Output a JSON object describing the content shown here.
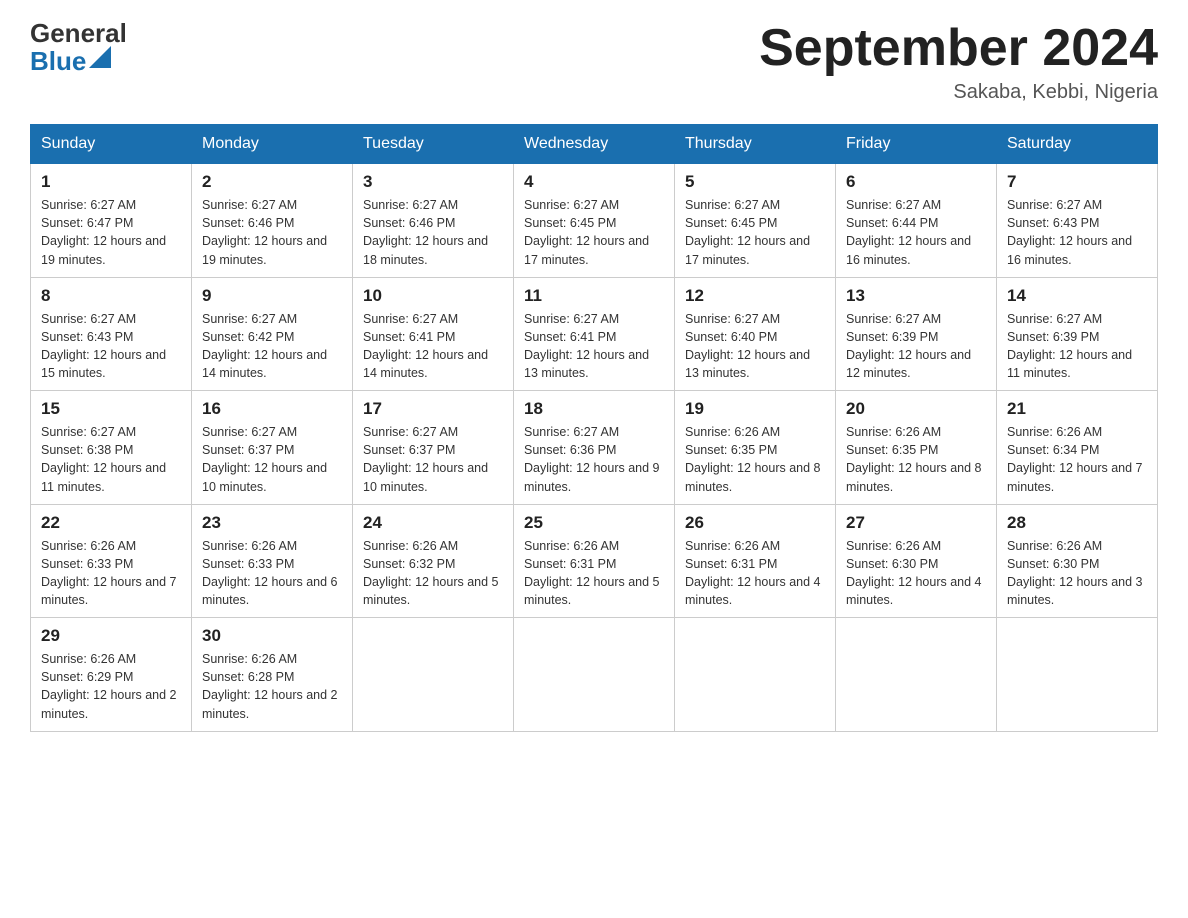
{
  "header": {
    "logo_general": "General",
    "logo_blue": "Blue",
    "month_title": "September 2024",
    "location": "Sakaba, Kebbi, Nigeria"
  },
  "days_of_week": [
    "Sunday",
    "Monday",
    "Tuesday",
    "Wednesday",
    "Thursday",
    "Friday",
    "Saturday"
  ],
  "weeks": [
    [
      {
        "day": "1",
        "sunrise": "Sunrise: 6:27 AM",
        "sunset": "Sunset: 6:47 PM",
        "daylight": "Daylight: 12 hours and 19 minutes."
      },
      {
        "day": "2",
        "sunrise": "Sunrise: 6:27 AM",
        "sunset": "Sunset: 6:46 PM",
        "daylight": "Daylight: 12 hours and 19 minutes."
      },
      {
        "day": "3",
        "sunrise": "Sunrise: 6:27 AM",
        "sunset": "Sunset: 6:46 PM",
        "daylight": "Daylight: 12 hours and 18 minutes."
      },
      {
        "day": "4",
        "sunrise": "Sunrise: 6:27 AM",
        "sunset": "Sunset: 6:45 PM",
        "daylight": "Daylight: 12 hours and 17 minutes."
      },
      {
        "day": "5",
        "sunrise": "Sunrise: 6:27 AM",
        "sunset": "Sunset: 6:45 PM",
        "daylight": "Daylight: 12 hours and 17 minutes."
      },
      {
        "day": "6",
        "sunrise": "Sunrise: 6:27 AM",
        "sunset": "Sunset: 6:44 PM",
        "daylight": "Daylight: 12 hours and 16 minutes."
      },
      {
        "day": "7",
        "sunrise": "Sunrise: 6:27 AM",
        "sunset": "Sunset: 6:43 PM",
        "daylight": "Daylight: 12 hours and 16 minutes."
      }
    ],
    [
      {
        "day": "8",
        "sunrise": "Sunrise: 6:27 AM",
        "sunset": "Sunset: 6:43 PM",
        "daylight": "Daylight: 12 hours and 15 minutes."
      },
      {
        "day": "9",
        "sunrise": "Sunrise: 6:27 AM",
        "sunset": "Sunset: 6:42 PM",
        "daylight": "Daylight: 12 hours and 14 minutes."
      },
      {
        "day": "10",
        "sunrise": "Sunrise: 6:27 AM",
        "sunset": "Sunset: 6:41 PM",
        "daylight": "Daylight: 12 hours and 14 minutes."
      },
      {
        "day": "11",
        "sunrise": "Sunrise: 6:27 AM",
        "sunset": "Sunset: 6:41 PM",
        "daylight": "Daylight: 12 hours and 13 minutes."
      },
      {
        "day": "12",
        "sunrise": "Sunrise: 6:27 AM",
        "sunset": "Sunset: 6:40 PM",
        "daylight": "Daylight: 12 hours and 13 minutes."
      },
      {
        "day": "13",
        "sunrise": "Sunrise: 6:27 AM",
        "sunset": "Sunset: 6:39 PM",
        "daylight": "Daylight: 12 hours and 12 minutes."
      },
      {
        "day": "14",
        "sunrise": "Sunrise: 6:27 AM",
        "sunset": "Sunset: 6:39 PM",
        "daylight": "Daylight: 12 hours and 11 minutes."
      }
    ],
    [
      {
        "day": "15",
        "sunrise": "Sunrise: 6:27 AM",
        "sunset": "Sunset: 6:38 PM",
        "daylight": "Daylight: 12 hours and 11 minutes."
      },
      {
        "day": "16",
        "sunrise": "Sunrise: 6:27 AM",
        "sunset": "Sunset: 6:37 PM",
        "daylight": "Daylight: 12 hours and 10 minutes."
      },
      {
        "day": "17",
        "sunrise": "Sunrise: 6:27 AM",
        "sunset": "Sunset: 6:37 PM",
        "daylight": "Daylight: 12 hours and 10 minutes."
      },
      {
        "day": "18",
        "sunrise": "Sunrise: 6:27 AM",
        "sunset": "Sunset: 6:36 PM",
        "daylight": "Daylight: 12 hours and 9 minutes."
      },
      {
        "day": "19",
        "sunrise": "Sunrise: 6:26 AM",
        "sunset": "Sunset: 6:35 PM",
        "daylight": "Daylight: 12 hours and 8 minutes."
      },
      {
        "day": "20",
        "sunrise": "Sunrise: 6:26 AM",
        "sunset": "Sunset: 6:35 PM",
        "daylight": "Daylight: 12 hours and 8 minutes."
      },
      {
        "day": "21",
        "sunrise": "Sunrise: 6:26 AM",
        "sunset": "Sunset: 6:34 PM",
        "daylight": "Daylight: 12 hours and 7 minutes."
      }
    ],
    [
      {
        "day": "22",
        "sunrise": "Sunrise: 6:26 AM",
        "sunset": "Sunset: 6:33 PM",
        "daylight": "Daylight: 12 hours and 7 minutes."
      },
      {
        "day": "23",
        "sunrise": "Sunrise: 6:26 AM",
        "sunset": "Sunset: 6:33 PM",
        "daylight": "Daylight: 12 hours and 6 minutes."
      },
      {
        "day": "24",
        "sunrise": "Sunrise: 6:26 AM",
        "sunset": "Sunset: 6:32 PM",
        "daylight": "Daylight: 12 hours and 5 minutes."
      },
      {
        "day": "25",
        "sunrise": "Sunrise: 6:26 AM",
        "sunset": "Sunset: 6:31 PM",
        "daylight": "Daylight: 12 hours and 5 minutes."
      },
      {
        "day": "26",
        "sunrise": "Sunrise: 6:26 AM",
        "sunset": "Sunset: 6:31 PM",
        "daylight": "Daylight: 12 hours and 4 minutes."
      },
      {
        "day": "27",
        "sunrise": "Sunrise: 6:26 AM",
        "sunset": "Sunset: 6:30 PM",
        "daylight": "Daylight: 12 hours and 4 minutes."
      },
      {
        "day": "28",
        "sunrise": "Sunrise: 6:26 AM",
        "sunset": "Sunset: 6:30 PM",
        "daylight": "Daylight: 12 hours and 3 minutes."
      }
    ],
    [
      {
        "day": "29",
        "sunrise": "Sunrise: 6:26 AM",
        "sunset": "Sunset: 6:29 PM",
        "daylight": "Daylight: 12 hours and 2 minutes."
      },
      {
        "day": "30",
        "sunrise": "Sunrise: 6:26 AM",
        "sunset": "Sunset: 6:28 PM",
        "daylight": "Daylight: 12 hours and 2 minutes."
      },
      null,
      null,
      null,
      null,
      null
    ]
  ]
}
